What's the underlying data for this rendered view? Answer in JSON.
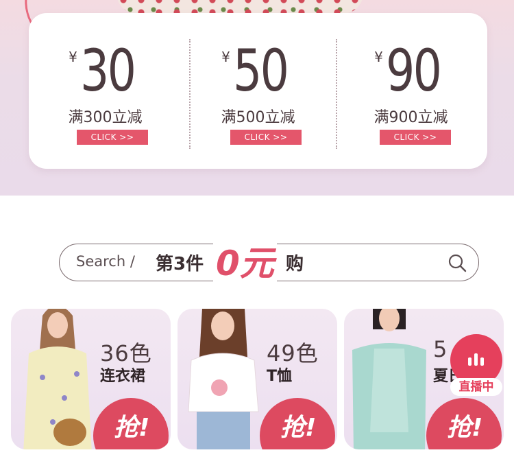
{
  "coupons": [
    {
      "currency": "¥",
      "amount": "30",
      "condition": "满300立减",
      "cta": "CLICK >>"
    },
    {
      "currency": "¥",
      "amount": "50",
      "condition": "满500立减",
      "cta": "CLICK >>"
    },
    {
      "currency": "¥",
      "amount": "90",
      "condition": "满900立减",
      "cta": "CLICK >>"
    }
  ],
  "search": {
    "label": "Search /",
    "promo_prefix": "第3件",
    "promo_highlight": "0元",
    "promo_suffix": "购"
  },
  "products": [
    {
      "count": "36色",
      "category": "连衣裙",
      "cta": "抢!",
      "outfit_color": "#f2ecc0"
    },
    {
      "count": "49色",
      "category": "T恤",
      "cta": "抢!",
      "outfit_color": "#ffffff"
    },
    {
      "count": "5",
      "category": "夏日",
      "cta": "抢!",
      "outfit_color": "#a9d8cf"
    }
  ],
  "live_badge": {
    "label": "直播中",
    "icon": "bars-icon",
    "color": "#e5405c"
  },
  "colors": {
    "accent": "#e4566b",
    "text": "#4b3b3f",
    "card_bg": "#ffffff"
  }
}
